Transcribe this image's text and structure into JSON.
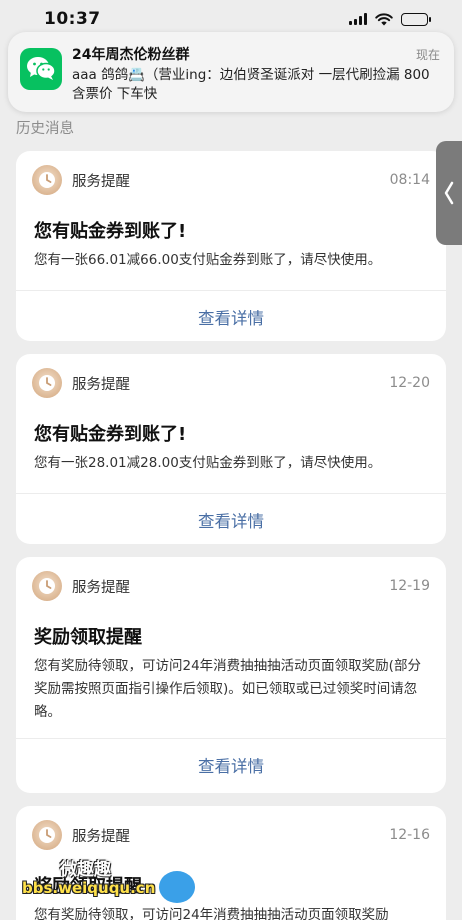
{
  "status_bar": {
    "time": "10:37"
  },
  "notification": {
    "title": "24年周杰伦粉丝群",
    "time": "现在",
    "message": "aaa 鸽鸽📇（营业ing：边伯贤圣诞派对  一层代刷捡漏 800含票价 下车快"
  },
  "history_label": "历史消息",
  "cards": [
    {
      "source": "服务提醒",
      "time": "08:14",
      "title": "您有贴金券到账了!",
      "desc": "您有一张66.01减66.00支付贴金券到账了，请尽快使用。",
      "action": "查看详情"
    },
    {
      "source": "服务提醒",
      "time": "12-20",
      "title": "您有贴金券到账了!",
      "desc": "您有一张28.01减28.00支付贴金券到账了，请尽快使用。",
      "action": "查看详情"
    },
    {
      "source": "服务提醒",
      "time": "12-19",
      "title": "奖励领取提醒",
      "desc": "您有奖励待领取，可访问24年消费抽抽抽活动页面领取奖励(部分奖励需按照页面指引操作后领取)。如已领取或已过领奖时间请忽略。",
      "action": "查看详情"
    },
    {
      "source": "服务提醒",
      "time": "12-16",
      "title": "奖励领取提醒",
      "desc": "您有奖励待领取，可访问24年消费抽抽抽活动页面领取奖励",
      "action": ""
    }
  ],
  "watermark": {
    "line1": "微趣趣",
    "line2": "bbs.weiququ.cn"
  },
  "colors": {
    "wechat_green": "#07c160",
    "link_blue": "#4a6fa5",
    "background": "#ededed"
  }
}
